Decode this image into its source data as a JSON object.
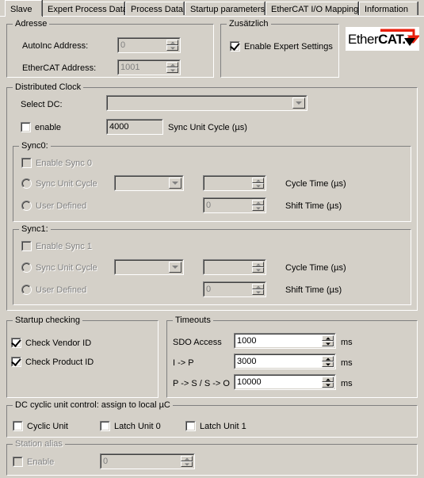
{
  "tabs": [
    {
      "label": "Slave",
      "selected": true
    },
    {
      "label": "Expert Process Data",
      "selected": false
    },
    {
      "label": "Process Data",
      "selected": false
    },
    {
      "label": "Startup parameters",
      "selected": false
    },
    {
      "label": "EtherCAT I/O Mapping",
      "selected": false
    },
    {
      "label": "Information",
      "selected": false
    }
  ],
  "adresse": {
    "title": "Adresse",
    "autoinc_label": "AutoInc Address:",
    "autoinc_value": "0",
    "ethercat_label": "EtherCAT Address:",
    "ethercat_value": "1001"
  },
  "zusaetzlich": {
    "title": "Zusätzlich",
    "expert_label": "Enable Expert Settings",
    "expert_checked": true
  },
  "logo": {
    "text_light": "Ether",
    "text_bold": "CAT.",
    "arrow_color": "#e8200e"
  },
  "distributed_clock": {
    "title": "Distributed Clock",
    "select_dc_label": "Select DC:",
    "select_dc_value": "",
    "enable_label": "enable",
    "enable_checked": false,
    "sync_unit_cycle_value": "4000",
    "sync_unit_cycle_label": "Sync Unit Cycle (µs)",
    "sync0": {
      "title": "Sync0:",
      "enable_label": "Enable Sync 0",
      "enable_checked": false,
      "radio_cycle_label": "Sync Unit Cycle",
      "radio_user_label": "User Defined",
      "combo_value": "",
      "cycle_time_value": "",
      "cycle_time_label": "Cycle Time (µs)",
      "shift_time_value": "0",
      "shift_time_label": "Shift Time (µs)"
    },
    "sync1": {
      "title": "Sync1:",
      "enable_label": "Enable Sync 1",
      "enable_checked": false,
      "radio_cycle_label": "Sync Unit Cycle",
      "radio_user_label": "User Defined",
      "combo_value": "",
      "cycle_time_value": "",
      "cycle_time_label": "Cycle Time (µs)",
      "shift_time_value": "0",
      "shift_time_label": "Shift Time (µs)"
    }
  },
  "startup_checking": {
    "title": "Startup checking",
    "vendor_label": "Check Vendor ID",
    "vendor_checked": true,
    "product_label": "Check Product ID",
    "product_checked": true
  },
  "timeouts": {
    "title": "Timeouts",
    "rows": [
      {
        "label": "SDO Access",
        "value": "1000",
        "unit": "ms"
      },
      {
        "label": "I -> P",
        "value": "3000",
        "unit": "ms"
      },
      {
        "label": "P -> S / S -> O",
        "value": "10000",
        "unit": "ms"
      }
    ]
  },
  "dc_cyclic": {
    "title": "DC cyclic unit control: assign to local µC",
    "items": [
      {
        "label": "Cyclic Unit",
        "checked": false
      },
      {
        "label": "Latch Unit 0",
        "checked": false
      },
      {
        "label": "Latch Unit 1",
        "checked": false
      }
    ]
  },
  "station_alias": {
    "title": "Station alias",
    "enable_label": "Enable",
    "enable_checked": false,
    "value": "0"
  }
}
